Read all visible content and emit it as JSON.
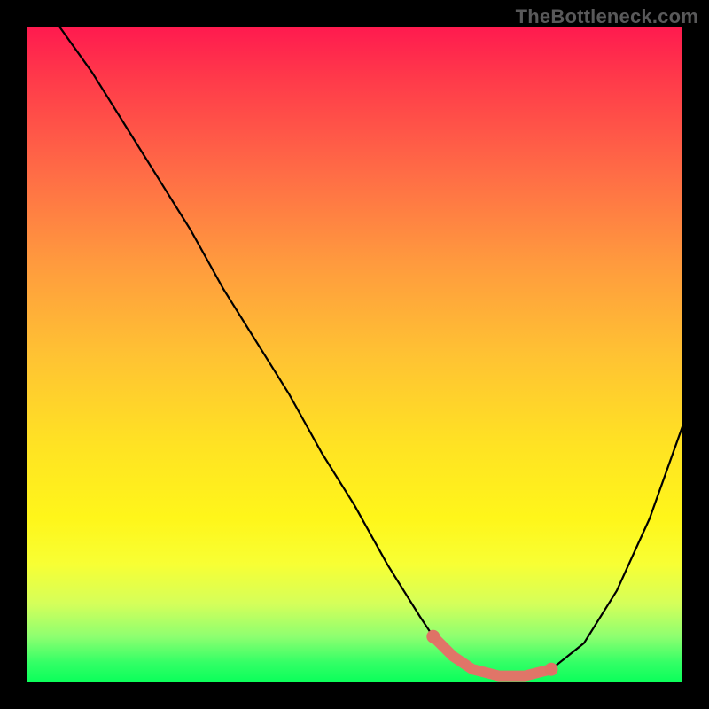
{
  "watermark": "TheBottleneck.com",
  "chart_data": {
    "type": "line",
    "title": "",
    "xlabel": "",
    "ylabel": "",
    "xlim": [
      0,
      100
    ],
    "ylim": [
      0,
      100
    ],
    "grid": false,
    "legend": false,
    "series": [
      {
        "name": "bottleneck-curve",
        "x": [
          5,
          10,
          15,
          20,
          25,
          30,
          35,
          40,
          45,
          50,
          55,
          60,
          62,
          65,
          68,
          72,
          76,
          80,
          85,
          90,
          95,
          100
        ],
        "y": [
          100,
          93,
          85,
          77,
          69,
          60,
          52,
          44,
          35,
          27,
          18,
          10,
          7,
          4,
          2,
          1,
          1,
          2,
          6,
          14,
          25,
          39
        ],
        "stroke": "#000000"
      },
      {
        "name": "optimal-range-marker",
        "x": [
          62,
          65,
          68,
          72,
          76,
          80
        ],
        "y": [
          7,
          4,
          2,
          1,
          1,
          2
        ],
        "stroke": "#e07568",
        "marker_endpoints": true
      }
    ],
    "background_gradient": {
      "direction": "vertical",
      "stops": [
        {
          "pos": 0,
          "color": "#ff1a4f"
        },
        {
          "pos": 50,
          "color": "#ffc233"
        },
        {
          "pos": 82,
          "color": "#f7ff34"
        },
        {
          "pos": 100,
          "color": "#0aff5a"
        }
      ]
    }
  }
}
